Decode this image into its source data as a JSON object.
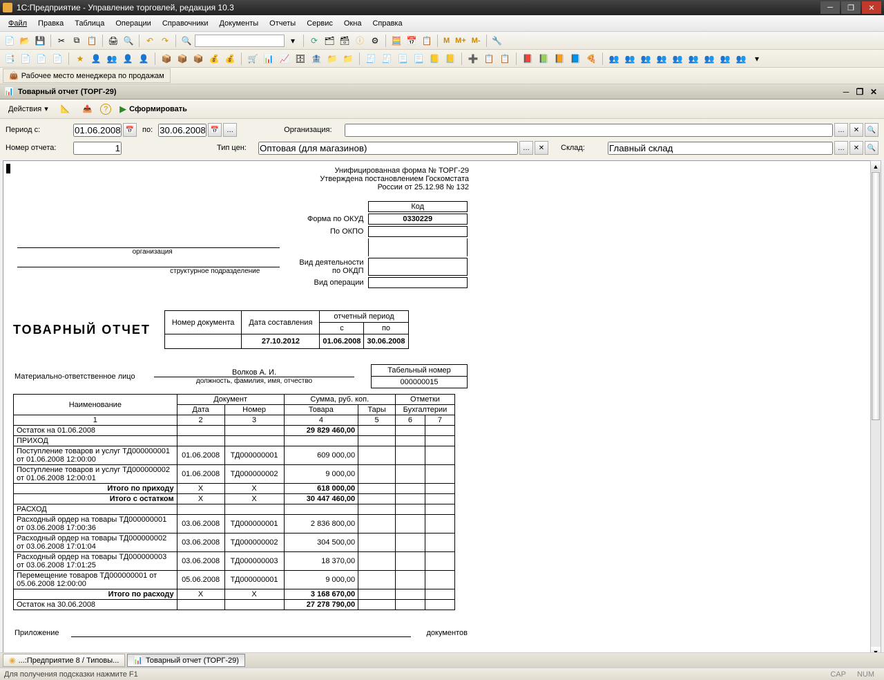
{
  "window": {
    "title": "1С:Предприятие - Управление торговлей, редакция 10.3"
  },
  "menu": [
    "Файл",
    "Правка",
    "Таблица",
    "Операции",
    "Справочники",
    "Документы",
    "Отчеты",
    "Сервис",
    "Окна",
    "Справка"
  ],
  "tb_letters": {
    "m": "М",
    "mp": "М+",
    "mm": "М-"
  },
  "quicklink": "Рабочее место менеджера по продажам",
  "subwin": {
    "title": "Товарный отчет (ТОРГ-29)"
  },
  "actions": {
    "dropdown": "Действия",
    "form": "Сформировать"
  },
  "filters": {
    "period_from_label": "Период с:",
    "period_from": "01.06.2008",
    "period_to_label": "по:",
    "period_to": "30.06.2008",
    "org_label": "Организация:",
    "org": "",
    "num_label": "Номер отчета:",
    "num": "1",
    "price_type_label": "Тип цен:",
    "price_type": "Оптовая (для магазинов)",
    "warehouse_label": "Склад:",
    "warehouse": "Главный склад"
  },
  "report": {
    "head1": "Унифицированная форма № ТОРГ-29",
    "head2": "Утверждена постановлением Госкомстата",
    "head3": "России от  25.12.98  № 132",
    "code_label": "Код",
    "okud_label": "Форма по ОКУД",
    "okud": "0330229",
    "okpo_label": "По ОКПО",
    "org_caption": "организация",
    "subdiv_caption": "структурное подразделение",
    "okdp_label": "Вид деятельности по ОКДП",
    "oper_label": "Вид операции",
    "docnum_h": "Номер документа",
    "docdate_h": "Дата составления",
    "period_h": "отчетный период",
    "from_h": "с",
    "to_h": "по",
    "docdate": "27.10.2012",
    "from": "01.06.2008",
    "to": "30.06.2008",
    "title": "ТОВАРНЫЙ  ОТЧЕТ",
    "resp_label": "Материально-ответственное лицо",
    "resp_name": "Волков А. И.",
    "resp_caption": "должность, фамилия, имя, отчество",
    "tabnum_label": "Табельный номер",
    "tabnum": "000000015",
    "cols": {
      "name": "Наименование",
      "doc": "Документ",
      "date": "Дата",
      "num": "Номер",
      "sum": "Сумма, руб. коп.",
      "goods": "Товара",
      "tare": "Тары",
      "marks": "Отметки",
      "bookkeep": "Бухгалтерии"
    },
    "colnums": [
      "1",
      "2",
      "3",
      "4",
      "5",
      "6",
      "7"
    ],
    "rows": {
      "r1": {
        "name": "Остаток на 01.06.2008",
        "goods": "29 829 460,00"
      },
      "r2": {
        "name": "ПРИХОД"
      },
      "r3": {
        "name": "Поступление товаров и услуг ТД000000001 от 01.06.2008 12:00:00",
        "date": "01.06.2008",
        "num": "ТД000000001",
        "goods": "609 000,00"
      },
      "r4": {
        "name": "Поступление товаров и услуг ТД000000002 от 01.06.2008 12:00:01",
        "date": "01.06.2008",
        "num": "ТД000000002",
        "goods": "9 000,00"
      },
      "r5": {
        "name": "Итого по приходу",
        "date": "Х",
        "num": "Х",
        "goods": "618 000,00"
      },
      "r6": {
        "name": "Итого с остатком",
        "date": "Х",
        "num": "Х",
        "goods": "30 447 460,00"
      },
      "r7": {
        "name": "РАСХОД"
      },
      "r8": {
        "name": "Расходный ордер на товары ТД000000001 от 03.06.2008 17:00:36",
        "date": "03.06.2008",
        "num": "ТД000000001",
        "goods": "2 836 800,00"
      },
      "r9": {
        "name": "Расходный ордер на товары ТД000000002 от 03.06.2008 17:01:04",
        "date": "03.06.2008",
        "num": "ТД000000002",
        "goods": "304 500,00"
      },
      "r10": {
        "name": "Расходный ордер на товары ТД000000003 от 03.06.2008 17:01:25",
        "date": "03.06.2008",
        "num": "ТД000000003",
        "goods": "18 370,00"
      },
      "r11": {
        "name": "Перемещение товаров ТД000000001 от 05.06.2008 12:00:00",
        "date": "05.06.2008",
        "num": "ТД000000001",
        "goods": "9 000,00"
      },
      "r12": {
        "name": "Итого по расходу",
        "date": "Х",
        "num": "Х",
        "goods": "3 168 670,00"
      },
      "r13": {
        "name": "Остаток на 30.06.2008",
        "goods": "27 278 790,00"
      }
    },
    "attach_label": "Приложение",
    "attach_suffix": "документов"
  },
  "tasks": [
    "...:Предприятие 8 / Типовы...",
    "Товарный отчет (ТОРГ-29)"
  ],
  "status": {
    "hint": "Для получения подсказки нажмите F1",
    "cap": "CAP",
    "num": "NUM"
  }
}
